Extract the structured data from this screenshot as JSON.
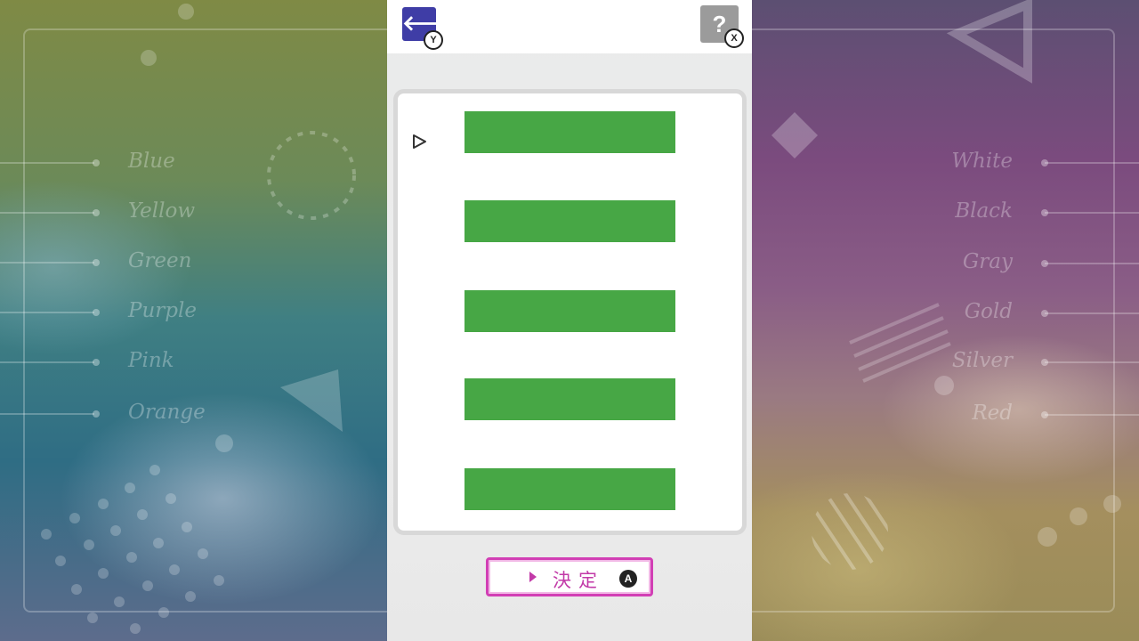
{
  "background": {
    "left_colors": [
      "Blue",
      "Yellow",
      "Green",
      "Purple",
      "Pink",
      "Orange"
    ],
    "right_colors": [
      "White",
      "Black",
      "Gray",
      "Gold",
      "Silver",
      "Red"
    ]
  },
  "topbar": {
    "back": {
      "icon": "back-arrow-icon",
      "symbol": "🡐",
      "key": "Y"
    },
    "help": {
      "icon": "help-icon",
      "symbol": "?",
      "key": "X"
    }
  },
  "list": {
    "selected_index": 0,
    "rows": 5,
    "row_color": "#47a745",
    "cursor_icon": "cursor-triangle-icon"
  },
  "confirm": {
    "label": "決定",
    "key": "A",
    "accent": "#c23aa8"
  }
}
